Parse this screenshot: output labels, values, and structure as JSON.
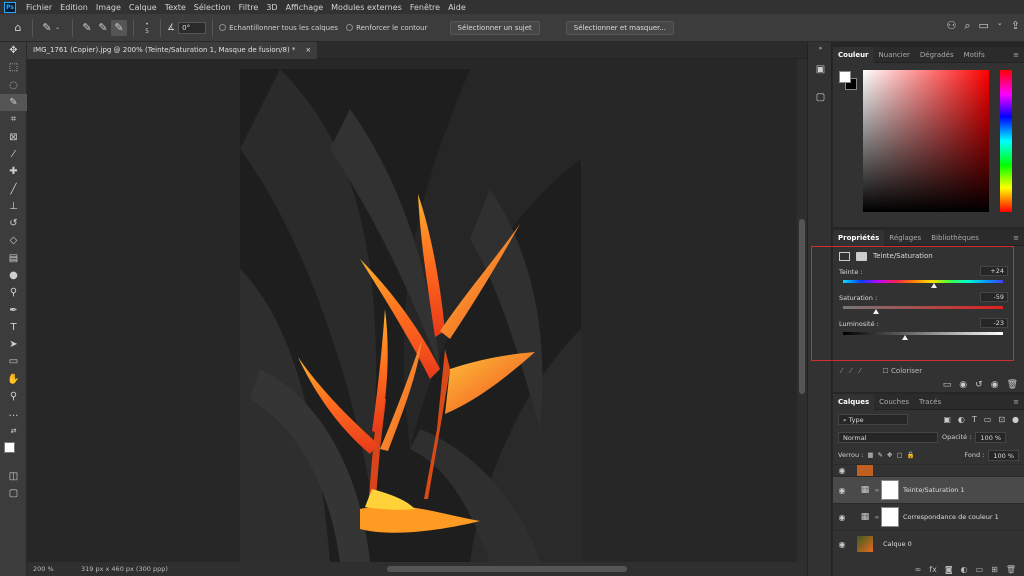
{
  "menubar": {
    "app_icon": "Ps",
    "items": [
      "Fichier",
      "Edition",
      "Image",
      "Calque",
      "Texte",
      "Sélection",
      "Filtre",
      "3D",
      "Affichage",
      "Modules externes",
      "Fenêtre",
      "Aide"
    ]
  },
  "options": {
    "brush_size": "5",
    "angle": "0°",
    "sample_all": "Echantillonner tous les calques",
    "enhance_edge": "Renforcer le contour",
    "select_subject": "Sélectionner un sujet",
    "select_mask": "Sélectionner et masquer..."
  },
  "document": {
    "tab_title": "IMG_1761 (Copier).jpg @ 200% (Teinte/Saturation 1, Masque de fusion/8) *",
    "close": "×"
  },
  "status": {
    "zoom": "200 %",
    "dims": "319 px x 460 px (300 ppp)"
  },
  "color_panel": {
    "tabs": [
      "Couleur",
      "Nuancier",
      "Dégradés",
      "Motifs"
    ],
    "active": "Couleur"
  },
  "properties": {
    "tabs": [
      "Propriétés",
      "Réglages",
      "Bibliothèques"
    ],
    "active": "Propriétés",
    "title": "Teinte/Saturation",
    "hue": {
      "label": "Teinte :",
      "value": "+24",
      "level": 0.57
    },
    "saturation": {
      "label": "Saturation :",
      "value": "-59",
      "level": 0.205
    },
    "lightness": {
      "label": "Luminosité :",
      "value": "-23",
      "level": 0.385
    },
    "colorize": "Coloriser"
  },
  "layers": {
    "tabs": [
      "Calques",
      "Couches",
      "Tracés"
    ],
    "active": "Calques",
    "filter": "Type",
    "blend": "Normal",
    "opacity_label": "Opacité :",
    "opacity": "100 %",
    "lock_label": "Verrou :",
    "fill_label": "Fond :",
    "fill": "100 %",
    "items": [
      {
        "name": "Teinte/Saturation 1"
      },
      {
        "name": "Correspondance de couleur 1"
      },
      {
        "name": "Calque 0"
      }
    ]
  }
}
